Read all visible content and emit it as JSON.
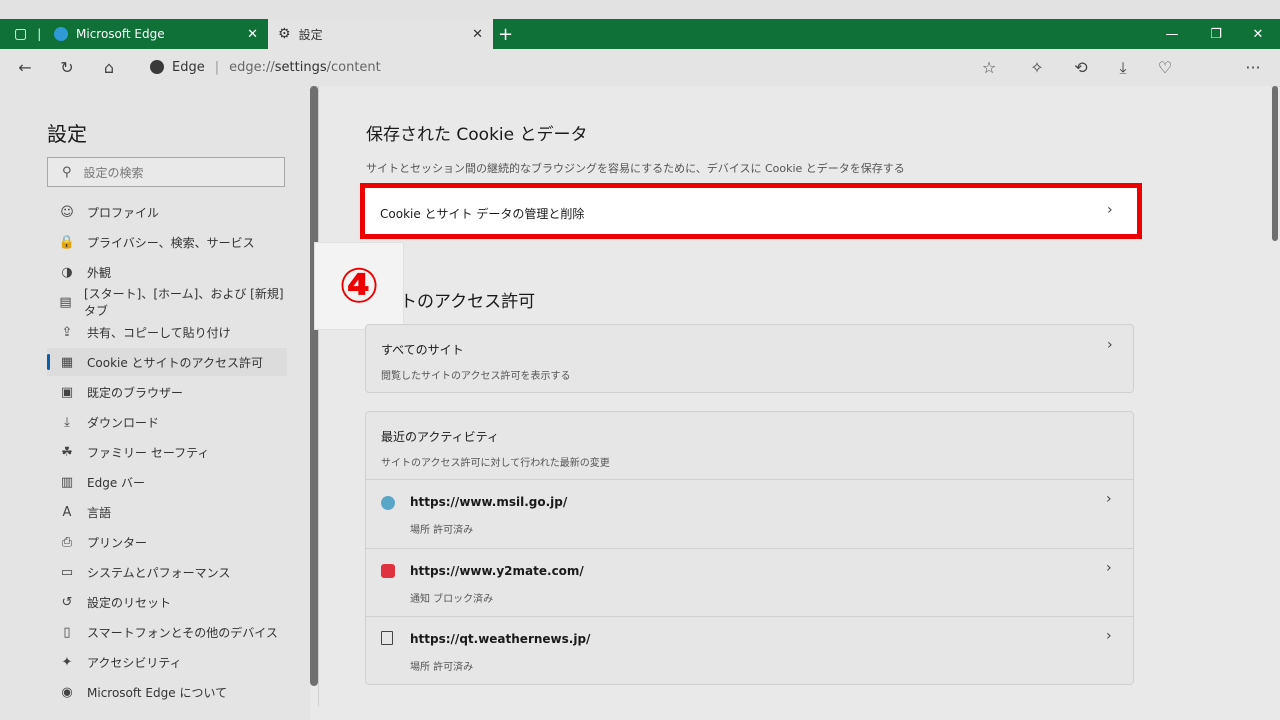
{
  "browser": {
    "tabs": [
      {
        "title": "Microsoft Edge"
      },
      {
        "title": "設定"
      }
    ],
    "address": {
      "site": "Edge",
      "url_prefix": "edge://",
      "url_bold": "settings",
      "url_suffix": "/content"
    }
  },
  "sidebar": {
    "title": "設定",
    "search_placeholder": "設定の検索",
    "items": [
      {
        "label": "プロファイル",
        "icon": "profile-icon"
      },
      {
        "label": "プライバシー、検索、サービス",
        "icon": "lock-icon"
      },
      {
        "label": "外観",
        "icon": "appearance-icon"
      },
      {
        "label": "[スタート]、[ホーム]、および [新規] タブ",
        "icon": "home-tab-icon"
      },
      {
        "label": "共有、コピーして貼り付け",
        "icon": "share-icon"
      },
      {
        "label": "Cookie とサイトのアクセス許可",
        "icon": "cookie-icon"
      },
      {
        "label": "既定のブラウザー",
        "icon": "browser-icon"
      },
      {
        "label": "ダウンロード",
        "icon": "download-icon"
      },
      {
        "label": "ファミリー セーフティ",
        "icon": "family-icon"
      },
      {
        "label": "Edge バー",
        "icon": "edge-bar-icon"
      },
      {
        "label": "言語",
        "icon": "language-icon"
      },
      {
        "label": "プリンター",
        "icon": "printer-icon"
      },
      {
        "label": "システムとパフォーマンス",
        "icon": "system-icon"
      },
      {
        "label": "設定のリセット",
        "icon": "reset-icon"
      },
      {
        "label": "スマートフォンとその他のデバイス",
        "icon": "phone-icon"
      },
      {
        "label": "アクセシビリティ",
        "icon": "accessibility-icon"
      },
      {
        "label": "Microsoft Edge について",
        "icon": "edge-logo-icon"
      }
    ]
  },
  "main": {
    "cookies": {
      "heading": "保存された Cookie とデータ",
      "description": "サイトとセッション間の継続的なブラウジングを容易にするために、デバイスに Cookie とデータを保存する",
      "manage_label": "Cookie とサイト データの管理と削除"
    },
    "marker": "④",
    "permissions": {
      "heading": "サイトのアクセス許可",
      "all_sites_title": "すべてのサイト",
      "all_sites_sub": "閲覧したサイトのアクセス許可を表示する",
      "recent_title": "最近のアクティビティ",
      "recent_sub": "サイトのアクセス許可に対して行われた最新の変更",
      "sites": [
        {
          "url": "https://www.msil.go.jp/",
          "status": "場所 許可済み"
        },
        {
          "url": "https://www.y2mate.com/",
          "status": "通知 ブロック済み"
        },
        {
          "url": "https://qt.weathernews.jp/",
          "status": "場所 許可済み"
        }
      ]
    }
  }
}
